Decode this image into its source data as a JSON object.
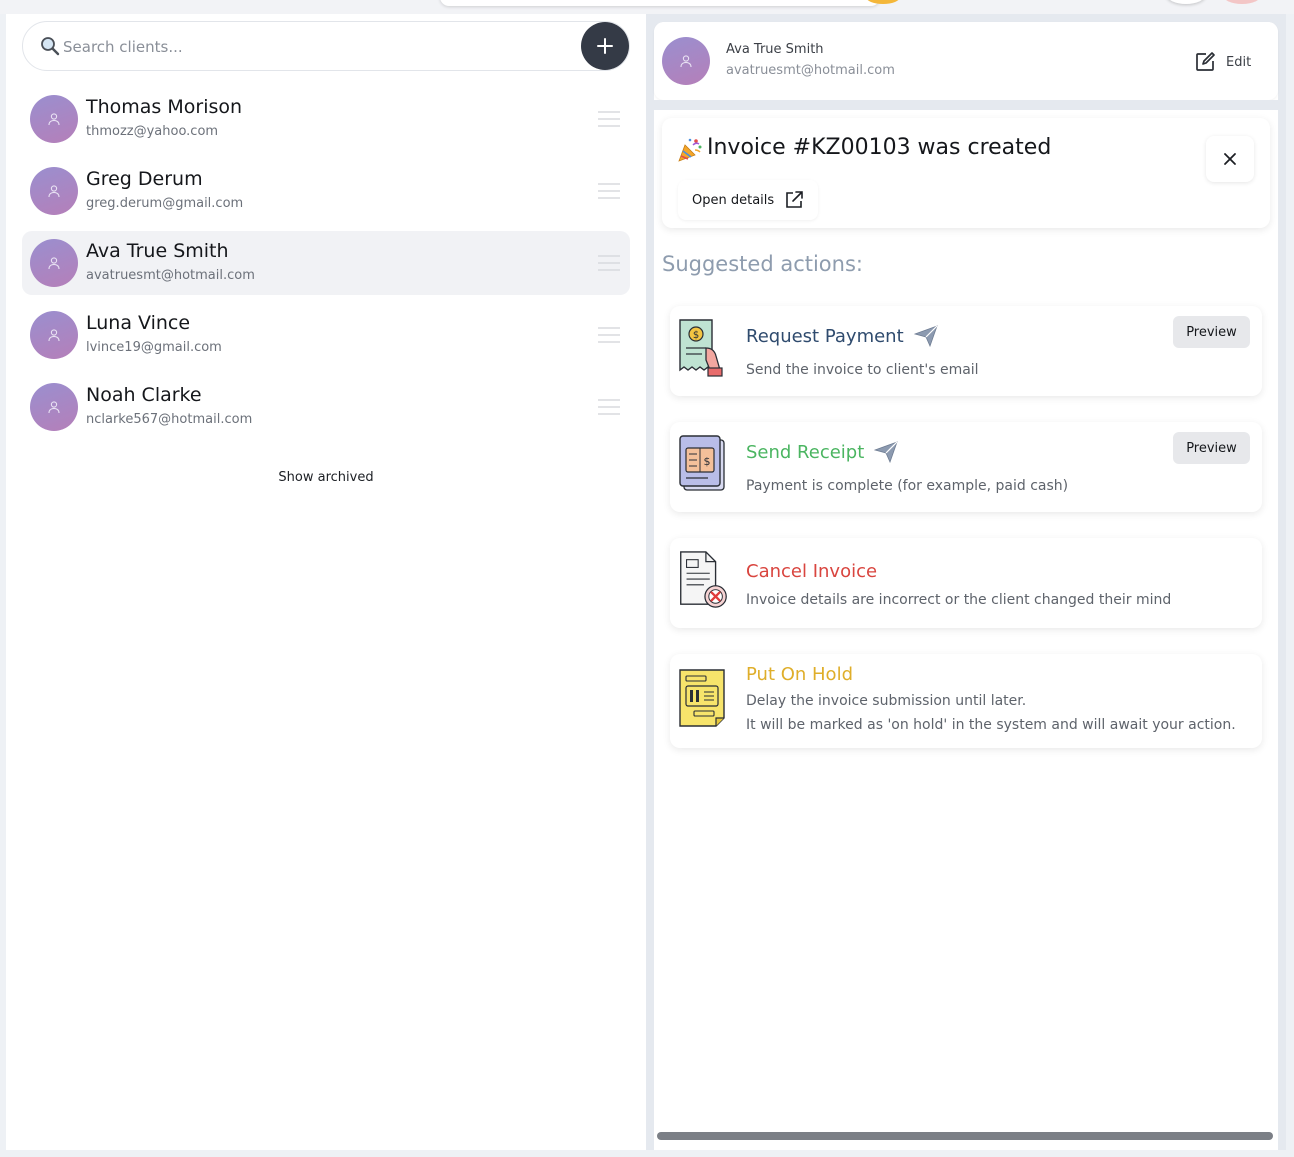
{
  "search": {
    "placeholder": "Search clients..."
  },
  "clients": [
    {
      "name": "Thomas Morison",
      "email": "thmozz@yahoo.com"
    },
    {
      "name": "Greg Derum",
      "email": "greg.derum@gmail.com"
    },
    {
      "name": "Ava True Smith",
      "email": "avatruesmt@hotmail.com",
      "selected": true
    },
    {
      "name": "Luna Vince",
      "email": "lvince19@gmail.com"
    },
    {
      "name": "Noah Clarke",
      "email": "nclarke567@hotmail.com"
    }
  ],
  "show_archived_label": "Show archived",
  "client_header": {
    "name": "Ava True Smith",
    "email": "avatruesmt@hotmail.com",
    "edit_label": "Edit"
  },
  "toast": {
    "emoji_icon": "party-popper-icon",
    "title": "Invoice #KZ00103 was created",
    "open_details_label": "Open details"
  },
  "suggested": {
    "title": "Suggested actions:",
    "actions": [
      {
        "title": "Request Payment",
        "description": "Send the invoice to client's email",
        "color": "#2f4b6e",
        "preview_label": "Preview"
      },
      {
        "title": "Send Receipt",
        "description": "Payment is complete (for example, paid cash)",
        "color": "#4bb561",
        "preview_label": "Preview"
      },
      {
        "title": "Cancel Invoice",
        "description": "Invoice details are incorrect or the client changed their mind",
        "color": "#d9453f"
      },
      {
        "title": "Put On Hold",
        "description": "Delay the invoice submission until later.",
        "description2": "It will be marked as 'on hold' in the system and will await your action.",
        "color": "#dfae2a"
      }
    ]
  },
  "colors": {
    "accent_dark": "#343a46",
    "selected_row": "#f1f2f5",
    "muted_heading": "#8e9cae"
  }
}
